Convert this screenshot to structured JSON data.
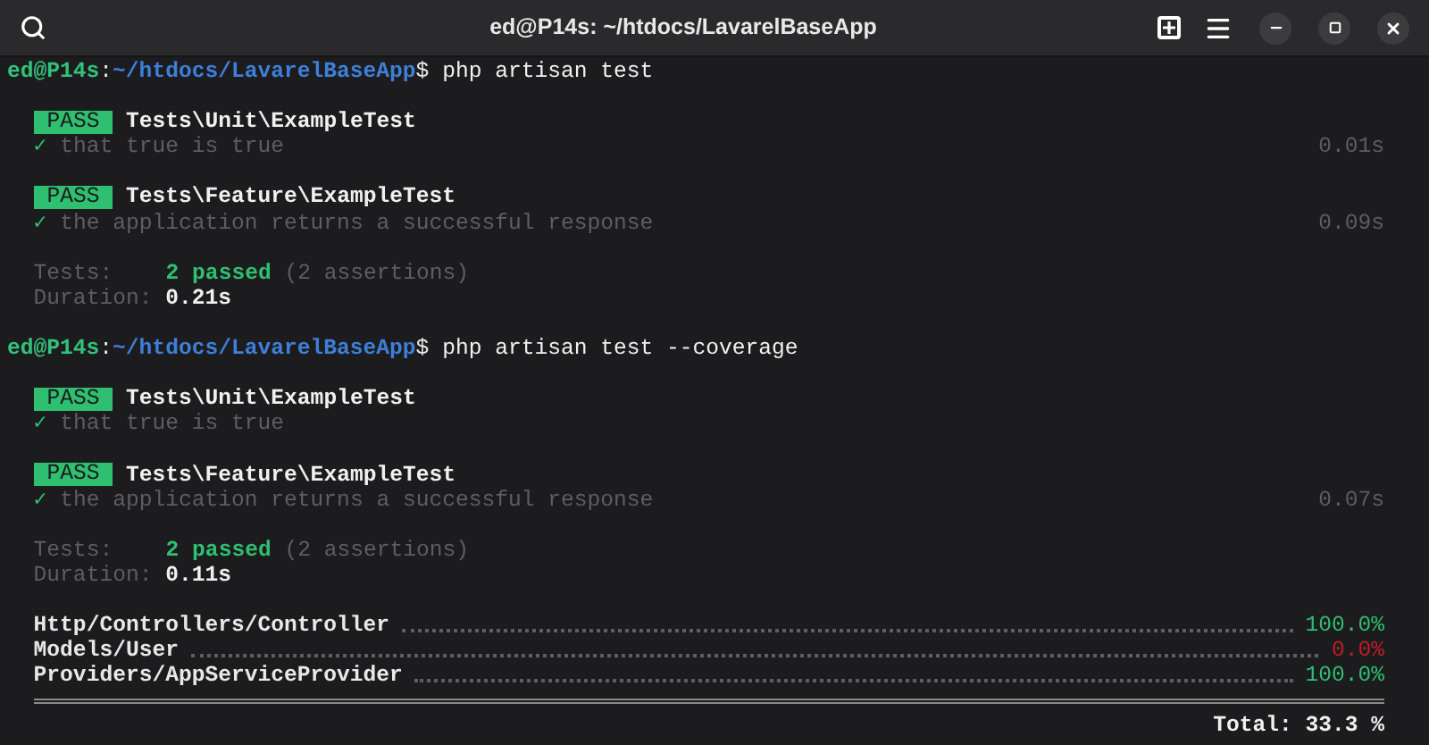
{
  "window": {
    "title": "ed@P14s: ~/htdocs/LavarelBaseApp"
  },
  "runs": [
    {
      "prompt": {
        "user": "ed@P14s",
        "separator": ":",
        "path": "~/htdocs/LavarelBaseApp",
        "symbol": "$"
      },
      "command": "php artisan test",
      "tests": [
        {
          "status": "PASS",
          "name": "Tests\\Unit\\ExampleTest",
          "check": "✓",
          "description": "that true is true",
          "time": "0.01s"
        },
        {
          "status": "PASS",
          "name": "Tests\\Feature\\ExampleTest",
          "check": "✓",
          "description": "the application returns a successful response",
          "time": "0.09s"
        }
      ],
      "summary": {
        "tests_label": "Tests:",
        "passed": "2 passed",
        "assertions": "(2 assertions)",
        "duration_label": "Duration:",
        "duration": "0.21s"
      }
    },
    {
      "prompt": {
        "user": "ed@P14s",
        "separator": ":",
        "path": "~/htdocs/LavarelBaseApp",
        "symbol": "$"
      },
      "command": "php artisan test --coverage",
      "tests": [
        {
          "status": "PASS",
          "name": "Tests\\Unit\\ExampleTest",
          "check": "✓",
          "description": "that true is true"
        },
        {
          "status": "PASS",
          "name": "Tests\\Feature\\ExampleTest",
          "check": "✓",
          "description": "the application returns a successful response",
          "time": "0.07s"
        }
      ],
      "summary": {
        "tests_label": "Tests:",
        "passed": "2 passed",
        "assertions": "(2 assertions)",
        "duration_label": "Duration:",
        "duration": "0.11s"
      },
      "coverage": {
        "rows": [
          {
            "file": "Http/Controllers/Controller",
            "percent": "100.0%",
            "covered": true
          },
          {
            "file": "Models/User",
            "percent": "0.0%",
            "covered": false
          },
          {
            "file": "Providers/AppServiceProvider",
            "percent": "100.0%",
            "covered": true
          }
        ],
        "total": "Total: 33.3 %"
      }
    }
  ]
}
